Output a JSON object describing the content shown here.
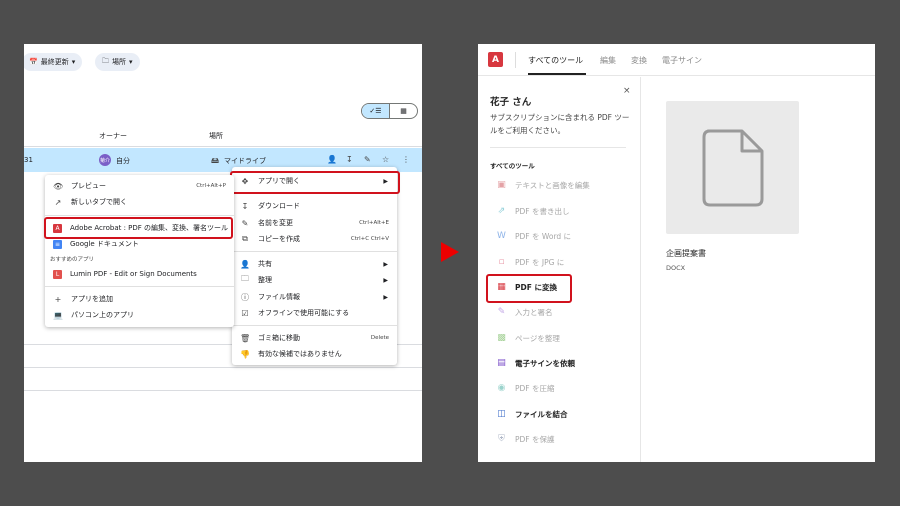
{
  "drive": {
    "filters": {
      "modified": "最終更新",
      "location": "場所"
    },
    "columns": {
      "owner": "オーナー",
      "location": "場所"
    },
    "row": {
      "date_fragment": "31",
      "avatar": "菊介",
      "owner": "自分",
      "location": "マイドライブ"
    },
    "context_menu": {
      "open_with": "アプリで開く",
      "download": "ダウンロード",
      "rename": "名前を変更",
      "rename_shortcut": "Ctrl+Alt+E",
      "copy": "コピーを作成",
      "copy_shortcut": "Ctrl+C Ctrl+V",
      "share": "共有",
      "organize": "整理",
      "file_info": "ファイル情報",
      "offline": "オフラインで使用可能にする",
      "trash": "ゴミ箱に移動",
      "trash_shortcut": "Delete",
      "not_useful": "有効な候補ではありません"
    },
    "open_with_menu": {
      "preview": "プレビュー",
      "preview_shortcut": "Ctrl+Alt+P",
      "new_tab": "新しいタブで開く",
      "acrobat": "Adobe Acrobat : PDF の編集、変換、署名ツール",
      "gdocs": "Google ドキュメント",
      "suggested_label": "おすすめのアプリ",
      "lumin": "Lumin PDF - Edit or Sign Documents",
      "add_app": "アプリを追加",
      "computer_apps": "パソコン上のアプリ"
    }
  },
  "acrobat": {
    "logo": "A",
    "tabs": [
      "すべてのツール",
      "編集",
      "変換",
      "電子サイン"
    ],
    "close": "×",
    "user_name": "花子 さん",
    "subscription_note": "サブスクリプションに含まれる PDF ツールをご利用ください。",
    "tools_header": "すべてのツール",
    "tools": [
      "テキストと画像を編集",
      "PDF を書き出し",
      "PDF を Word に",
      "PDF を JPG に",
      "PDF に変換",
      "入力と署名",
      "ページを整理",
      "電子サインを依頼",
      "PDF を圧縮",
      "ファイルを結合",
      "PDF を保護"
    ],
    "file": {
      "name": "企画提案書",
      "type": "DOCX"
    }
  },
  "colors": {
    "highlight": "#d1121d",
    "selected_row": "#c2e7ff",
    "acrobat_red": "#d7373f",
    "arrow": "#ee0000"
  }
}
